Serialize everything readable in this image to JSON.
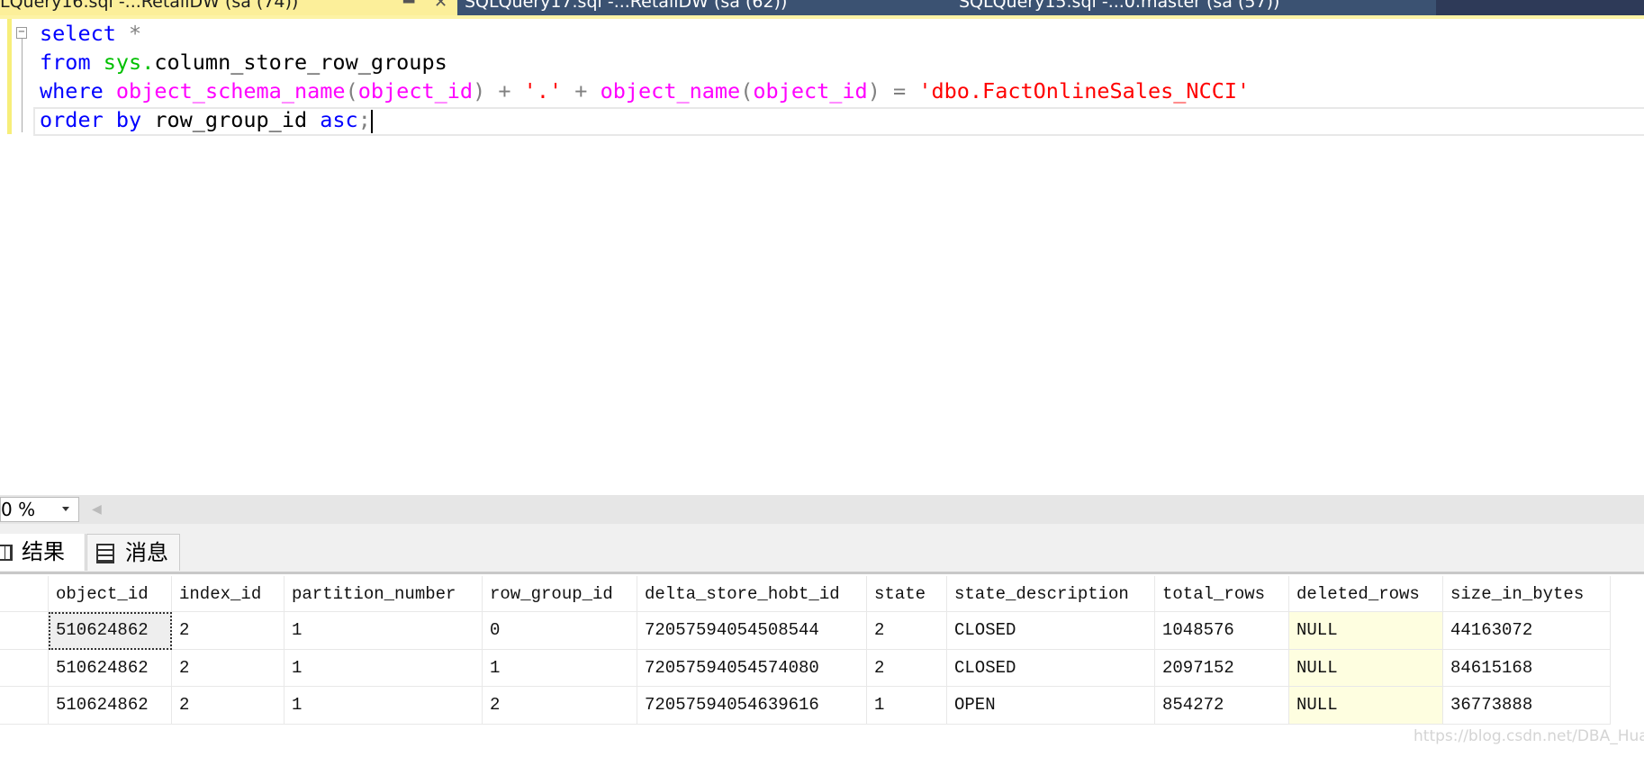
{
  "tabs": [
    {
      "label": "LQuery16.sql -...RetailDW (sa (74))",
      "active": true
    },
    {
      "label": "SQLQuery17.sql -...RetailDW (sa (62))"
    },
    {
      "label": "SQLQuery15.sql -...0.master (sa (57))"
    }
  ],
  "tab_icons": {
    "pin": "pin-icon",
    "close": "close-icon"
  },
  "code_lines": [
    [
      [
        "select",
        "kw"
      ],
      [
        " *",
        "op"
      ]
    ],
    [
      [
        "from",
        "kw"
      ],
      [
        " ",
        "id"
      ],
      [
        "sys.",
        "sys"
      ],
      [
        "column_store_row_groups",
        "id"
      ]
    ],
    [
      [
        "where",
        "kw"
      ],
      [
        " ",
        "id"
      ],
      [
        "object_schema_name",
        "fn"
      ],
      [
        "(",
        "op"
      ],
      [
        "object_id",
        "fn"
      ],
      [
        ") + ",
        "op"
      ],
      [
        "'.'",
        "str"
      ],
      [
        " + ",
        "op"
      ],
      [
        "object_name",
        "fn"
      ],
      [
        "(",
        "op"
      ],
      [
        "object_id",
        "fn"
      ],
      [
        ") = ",
        "op"
      ],
      [
        "'dbo.FactOnlineSales_NCCI'",
        "str"
      ]
    ],
    [
      [
        "order by",
        "kw"
      ],
      [
        " row_group_id ",
        "id"
      ],
      [
        "asc",
        "kw"
      ],
      [
        ";",
        "op"
      ]
    ]
  ],
  "colors": {
    "keyword": "#0000ff",
    "system": "#00c000",
    "function": "#ff00ff",
    "operator": "#808080",
    "string": "#ff0000"
  },
  "zoom": {
    "value": "0 %"
  },
  "result_tabs": [
    {
      "label": "结果",
      "icon": "grid-icon"
    },
    {
      "label": "消息",
      "icon": "messages-icon"
    }
  ],
  "grid": {
    "columns": [
      "object_id",
      "index_id",
      "partition_number",
      "row_group_id",
      "delta_store_hobt_id",
      "state",
      "state_description",
      "total_rows",
      "deleted_rows",
      "size_in_bytes"
    ],
    "rows": [
      [
        "510624862",
        "2",
        "1",
        "0",
        "72057594054508544",
        "2",
        "CLOSED",
        "1048576",
        "NULL",
        "44163072"
      ],
      [
        "510624862",
        "2",
        "1",
        "1",
        "72057594054574080",
        "2",
        "CLOSED",
        "2097152",
        "NULL",
        "84615168"
      ],
      [
        "510624862",
        "2",
        "1",
        "2",
        "72057594054639616",
        "1",
        "OPEN",
        "854272",
        "NULL",
        "36773888"
      ]
    ]
  },
  "watermark": "https://blog.csdn.net/DBA_Huangzj"
}
